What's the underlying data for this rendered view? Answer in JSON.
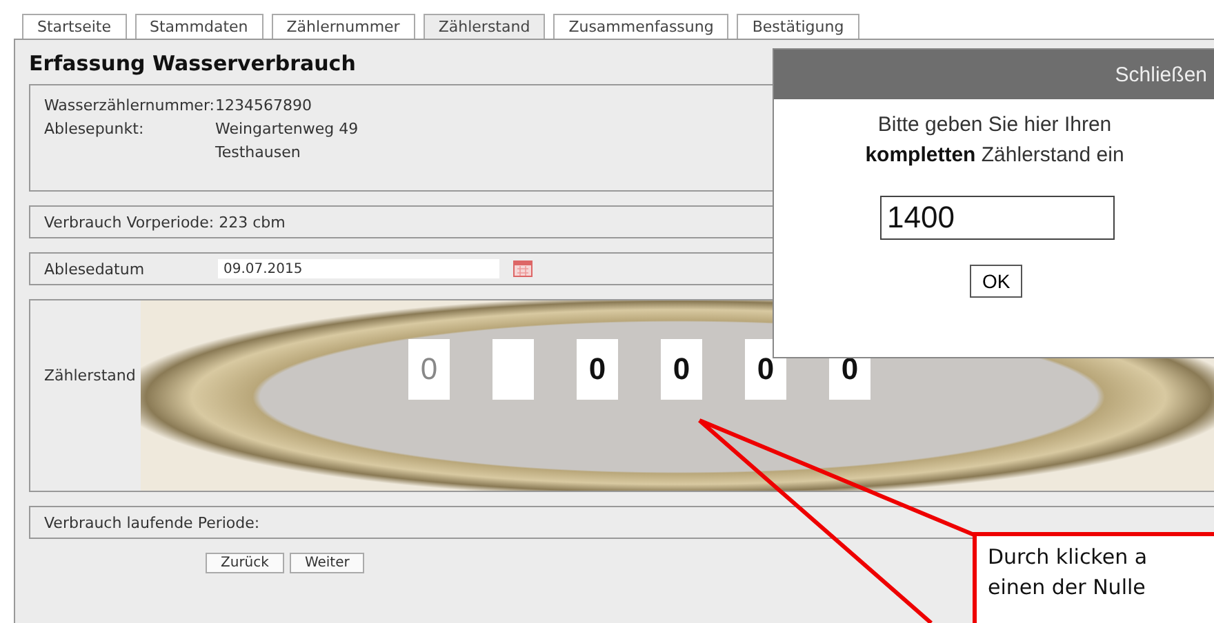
{
  "tabs": [
    {
      "label": "Startseite",
      "selected": false
    },
    {
      "label": "Stammdaten",
      "selected": false
    },
    {
      "label": "Zählernummer",
      "selected": false
    },
    {
      "label": "Zählerstand",
      "selected": true
    },
    {
      "label": "Zusammenfassung",
      "selected": false
    },
    {
      "label": "Bestätigung",
      "selected": false
    }
  ],
  "title": "Erfassung Wasserverbrauch",
  "meter_info": [
    {
      "label": "Wasserzählernummer:",
      "lines": [
        "1234567890"
      ]
    },
    {
      "label": "Ablesepunkt:",
      "lines": [
        "Weingartenweg 49",
        "Testhausen"
      ]
    }
  ],
  "previous_consumption": "Verbrauch Vorperiode: 223 cbm",
  "reading_date": {
    "label": "Ablesedatum",
    "value": "09.07.2015"
  },
  "meter_reading": {
    "label": "Zählerstand",
    "digits": [
      {
        "kind": "digit",
        "value": "0",
        "dimmed": true
      },
      {
        "kind": "blank"
      },
      {
        "kind": "digit",
        "value": "0",
        "dimmed": false
      },
      {
        "kind": "digit",
        "value": "0",
        "dimmed": false
      },
      {
        "kind": "digit",
        "value": "0",
        "dimmed": false
      },
      {
        "kind": "digit",
        "value": "0",
        "dimmed": false
      }
    ]
  },
  "current_consumption": "Verbrauch laufende Periode:",
  "buttons": [
    "Zurück",
    "Weiter"
  ],
  "dialog": {
    "close": "Schließen",
    "prompt": "Bitte geben Sie hier Ihren **kompletten** Zählerstand ein",
    "value": "1400",
    "ok": "OK"
  },
  "callout": {
    "lines": [
      "Durch klicken a",
      "einen der Nulle"
    ]
  }
}
